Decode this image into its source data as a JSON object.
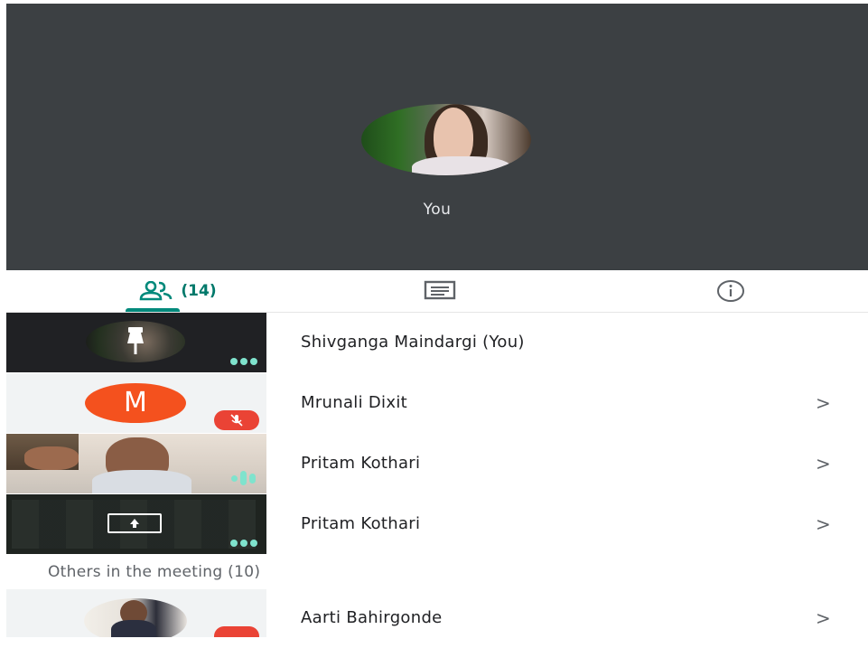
{
  "self_view": {
    "label": "You"
  },
  "tabs": {
    "people_count": "(14)"
  },
  "participants": [
    {
      "name": "Shivganga Maindargi (You)",
      "chevron": ""
    },
    {
      "name": "Mrunali Dixit",
      "avatar_letter": "M",
      "chevron": ">"
    },
    {
      "name": "Pritam Kothari",
      "chevron": ">"
    },
    {
      "name": "Pritam Kothari",
      "chevron": ">"
    }
  ],
  "others_section": {
    "label": "Others in the meeting (10)"
  },
  "others": [
    {
      "name": "Aarti Bahirgonde",
      "chevron": ">"
    }
  ],
  "colors": {
    "accent": "#00897b",
    "self_view_bg": "#3c4043",
    "avatar_m": "#f4511e",
    "muted": "#ea4335",
    "audio_dots": "#7fe3cd"
  },
  "icons": [
    "people-icon",
    "chat-icon",
    "info-icon",
    "pin-icon",
    "mic-off-icon",
    "present-icon"
  ]
}
